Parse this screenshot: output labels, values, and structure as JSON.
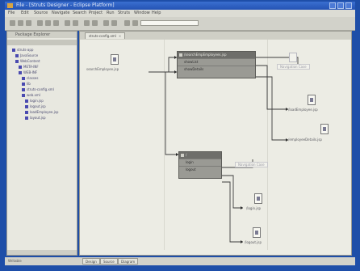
{
  "window": {
    "title": "File - [Struts Designer - Eclipse Platform]"
  },
  "menu": [
    "File",
    "Edit",
    "Source",
    "Navigate",
    "Search",
    "Project",
    "Run",
    "Struts",
    "Window",
    "Help"
  ],
  "left_panel": {
    "title": "Package Explorer"
  },
  "tree": [
    {
      "label": "struts-app",
      "indent": 2
    },
    {
      "label": "JavaSource",
      "indent": 6
    },
    {
      "label": "WebContent",
      "indent": 6
    },
    {
      "label": "META-INF",
      "indent": 10
    },
    {
      "label": "WEB-INF",
      "indent": 10
    },
    {
      "label": "classes",
      "indent": 14
    },
    {
      "label": "lib",
      "indent": 14
    },
    {
      "label": "struts-config.xml",
      "indent": 14
    },
    {
      "label": "web.xml",
      "indent": 14
    },
    {
      "label": "login.jsp",
      "indent": 18
    },
    {
      "label": "logout.jsp",
      "indent": 18
    },
    {
      "label": "loadEmployee.jsp",
      "indent": 18
    },
    {
      "label": "layout.jsp",
      "indent": 18
    }
  ],
  "editor": {
    "tab_label": "struts-config.xml",
    "close_glyph": "×",
    "start_page": "searchEmployee.jsp",
    "action1": {
      "header": "/searchEmpEmployees.jsp",
      "rows": [
        "showList",
        "showDetails"
      ]
    },
    "action2": {
      "header": "/",
      "rows": [
        "login",
        "logout"
      ]
    },
    "ghost1": "Navigation Case",
    "ghost2": "Navigation Case",
    "targets": [
      "/loadEmployee.jsp",
      "/employeeDetails.jsp",
      "/login.jsp",
      "/logout.jsp"
    ]
  },
  "statusbar": {
    "text": "Writable",
    "tabs": [
      "Design",
      "Source",
      "Diagram"
    ]
  },
  "colors": {
    "desktop": "#1e4ea8",
    "canvas": "#ecece4",
    "action_header": "#6e6e6a"
  }
}
